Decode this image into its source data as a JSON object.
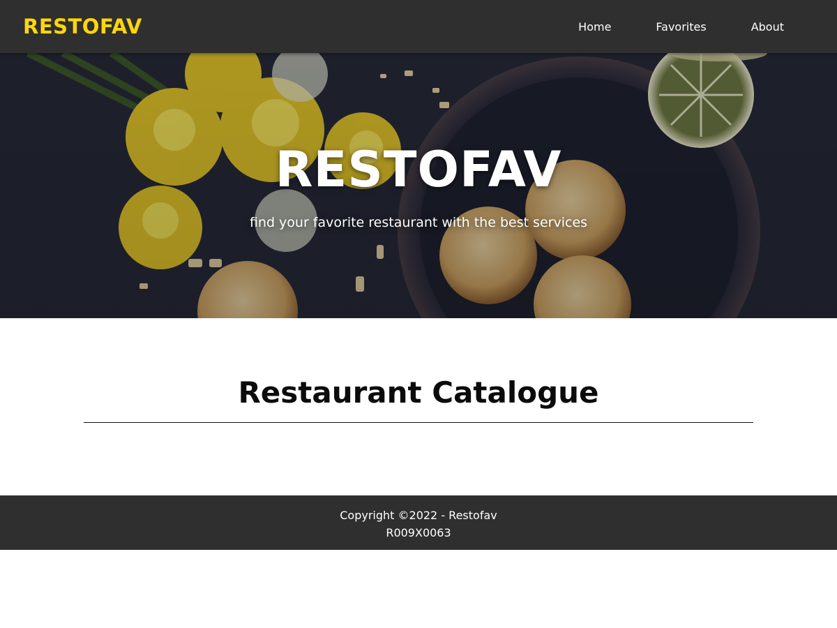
{
  "header": {
    "brand": "RESTOFAV",
    "nav": [
      {
        "label": "Home"
      },
      {
        "label": "Favorites"
      },
      {
        "label": "About"
      }
    ]
  },
  "hero": {
    "title": "RESTOFAV",
    "tagline": "find your favorite restaurant with the best services"
  },
  "main": {
    "heading": "Restaurant Catalogue"
  },
  "footer": {
    "copyright": "Copyright ©2022 - Restofav",
    "code": "R009X0063"
  },
  "colors": {
    "header_bg": "#2f2f2f",
    "brand_yellow": "#ffd60a",
    "footer_bg": "#2f2f2f",
    "hero_bg": "#262a38"
  },
  "icons": {
    "hero_image": "food-photo-cookies-daffodils-lemon"
  }
}
